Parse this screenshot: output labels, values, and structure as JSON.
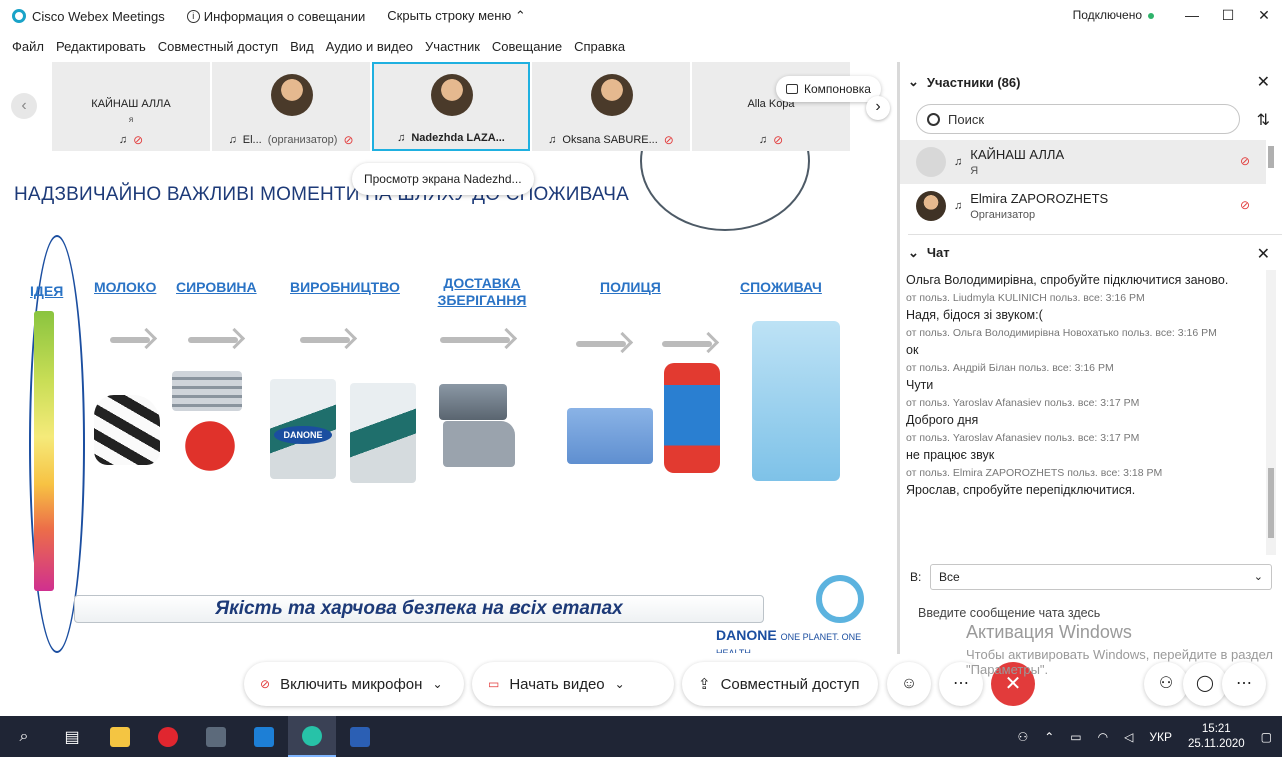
{
  "window": {
    "app_title": "Cisco Webex Meetings",
    "meeting_info": "Информация о совещании",
    "hide_menu": "Скрыть строку меню",
    "connection_status": "Подключено",
    "controls": [
      "—",
      "☐",
      "✕"
    ]
  },
  "menu": [
    "Файл",
    "Редактировать",
    "Совместный доступ",
    "Вид",
    "Аудио и видео",
    "Участник",
    "Совещание",
    "Справка"
  ],
  "video_strip": {
    "tiles": [
      {
        "name": "КАЙНАШ АЛЛА",
        "sub": "я",
        "footer": ""
      },
      {
        "name": "",
        "sub": "",
        "footer": "El...",
        "role": "(организатор)"
      },
      {
        "name": "",
        "sub": "",
        "footer": "Nadezhda LAZA..."
      },
      {
        "name": "",
        "sub": "",
        "footer": "Oksana SABURE..."
      },
      {
        "name": "Alla Kopa",
        "sub": "",
        "footer": ""
      }
    ],
    "layout_button": "Компоновка",
    "tooltip": "Просмотр экрана Nadezhd..."
  },
  "slide": {
    "title": "НАДЗВИЧАЙНО ВАЖЛИВІ МОМЕНТИ НА ШЛЯХУ ДО СПОЖИВАЧА",
    "steps": [
      "ІДЕЯ",
      "МОЛОКО",
      "СИРОВИНА",
      "ВИРОБНИЦТВО",
      "ДОСТАВКА ЗБЕРІГАННЯ",
      "ПОЛИЦЯ",
      "СПОЖИВАЧ"
    ],
    "banner": "Якість та харчова безпека на всіх етапах",
    "badge": "DANONE",
    "brand": "DANONE",
    "brand_tag": "ONE PLANET. ONE HEALTH"
  },
  "participants": {
    "header": "Участники (86)",
    "search_placeholder": "Поиск",
    "rows": [
      {
        "name": "КАЙНАШ АЛЛА",
        "role": "Я"
      },
      {
        "name": "Elmira ZAPOROZHETS",
        "role": "Организатор"
      }
    ]
  },
  "chat": {
    "header": "Чат",
    "messages": [
      {
        "type": "msg",
        "text": "Ольга Володимирівна, спробуйте підключитися заново."
      },
      {
        "type": "meta",
        "text": "от польз. Liudmyla KULINICH польз. все:     3:16 PM"
      },
      {
        "type": "msg",
        "text": "Надя, бідося зі звуком:("
      },
      {
        "type": "meta",
        "text": "от польз. Ольга Володимирівна Новохатько польз. все:     3:16 PM"
      },
      {
        "type": "msg",
        "text": "ок"
      },
      {
        "type": "meta",
        "text": "от польз. Андрій Білан польз. все:     3:16 PM"
      },
      {
        "type": "msg",
        "text": "Чути"
      },
      {
        "type": "meta",
        "text": "от польз. Yaroslav Afanasiev польз. все:     3:17 PM"
      },
      {
        "type": "msg",
        "text": "Доброго дня"
      },
      {
        "type": "meta",
        "text": "от польз. Yaroslav Afanasiev польз. все:     3:17 PM"
      },
      {
        "type": "msg",
        "text": "не працює звук"
      },
      {
        "type": "meta",
        "text": "от польз. Elmira ZAPOROZHETS польз. все:     3:18 PM"
      },
      {
        "type": "msg",
        "text": "Ярослав, спробуйте перепідключитися."
      }
    ],
    "to_label": "В:",
    "to_value": "Все",
    "input_placeholder": "Введите сообщение чата здесь"
  },
  "activation": {
    "title": "Активация Windows",
    "text": "Чтобы активировать Windows, перейдите в раздел \"Параметры\"."
  },
  "controls": {
    "mic": "Включить микрофон",
    "video": "Начать видео",
    "share": "Совместный доступ"
  },
  "taskbar": {
    "lang": "УКР",
    "time": "15:21",
    "date": "25.11.2020"
  },
  "colors": {
    "accent": "#1fb0e0",
    "mic_off": "#e23b3b",
    "leave": "#e23b3b",
    "taskbar": "#1f2535"
  }
}
